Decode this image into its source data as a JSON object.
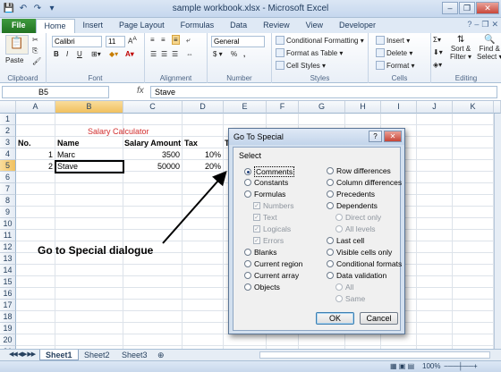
{
  "window": {
    "title": "sample workbook.xlsx - Microsoft Excel"
  },
  "qat": [
    "💾",
    "↶",
    "↷",
    "▾"
  ],
  "tabs": [
    "File",
    "Home",
    "Insert",
    "Page Layout",
    "Formulas",
    "Data",
    "Review",
    "View",
    "Developer"
  ],
  "ribbon": {
    "clipboard": {
      "label": "Clipboard",
      "paste": "Paste"
    },
    "font": {
      "label": "Font",
      "name": "Calibri",
      "size": "11",
      "bold": "B",
      "italic": "I",
      "underline": "U"
    },
    "alignment": {
      "label": "Alignment"
    },
    "number": {
      "label": "Number",
      "format": "General",
      "currency": "$ ▾",
      "percent": "%",
      "comma": ","
    },
    "styles": {
      "label": "Styles",
      "cond": "Conditional Formatting ▾",
      "table": "Format as Table ▾",
      "cell": "Cell Styles ▾"
    },
    "cells": {
      "label": "Cells",
      "insert": "Insert ▾",
      "delete": "Delete ▾",
      "format": "Format ▾"
    },
    "editing": {
      "label": "Editing",
      "sort": "Sort &",
      "sort2": "Filter ▾",
      "find": "Find &",
      "find2": "Select ▾"
    }
  },
  "formula_bar": {
    "namebox": "B5",
    "fx": "fx",
    "value": "Stave"
  },
  "columns": [
    "A",
    "B",
    "C",
    "D",
    "E",
    "F",
    "G",
    "H",
    "I",
    "J",
    "K"
  ],
  "rows": [
    "1",
    "2",
    "3",
    "4",
    "5",
    "6",
    "7",
    "8",
    "9",
    "10",
    "11",
    "12",
    "13",
    "14",
    "15",
    "16",
    "17",
    "18",
    "19",
    "20",
    "21"
  ],
  "cells": {
    "title": "Salary Calculator",
    "h_no": "No.",
    "h_name": "Name",
    "h_salary": "Salary Amount",
    "h_tax": "Tax",
    "h_t": "T",
    "r1_no": "1",
    "r1_name": "Marc",
    "r1_salary": "3500",
    "r1_tax": "10%",
    "r2_no": "2",
    "r2_name": "Stave",
    "r2_salary": "50000",
    "r2_tax": "20%"
  },
  "annotation": "Go to Special dialogue",
  "sheets": [
    "Sheet1",
    "Sheet2",
    "Sheet3"
  ],
  "status": {
    "zoom": "100%"
  },
  "dialog": {
    "title": "Go To Special",
    "select_label": "Select",
    "left": [
      {
        "label": "Comments",
        "type": "radio",
        "on": true
      },
      {
        "label": "Constants",
        "type": "radio"
      },
      {
        "label": "Formulas",
        "type": "radio"
      },
      {
        "label": "Numbers",
        "type": "check",
        "dis": true
      },
      {
        "label": "Text",
        "type": "check",
        "dis": true
      },
      {
        "label": "Logicals",
        "type": "check",
        "dis": true
      },
      {
        "label": "Errors",
        "type": "check",
        "dis": true
      },
      {
        "label": "Blanks",
        "type": "radio"
      },
      {
        "label": "Current region",
        "type": "radio"
      },
      {
        "label": "Current array",
        "type": "radio"
      },
      {
        "label": "Objects",
        "type": "radio"
      }
    ],
    "right": [
      {
        "label": "Row differences",
        "type": "radio"
      },
      {
        "label": "Column differences",
        "type": "radio"
      },
      {
        "label": "Precedents",
        "type": "radio"
      },
      {
        "label": "Dependents",
        "type": "radio"
      },
      {
        "label": "Direct only",
        "type": "radio",
        "dis": true
      },
      {
        "label": "All levels",
        "type": "radio",
        "dis": true
      },
      {
        "label": "Last cell",
        "type": "radio"
      },
      {
        "label": "Visible cells only",
        "type": "radio"
      },
      {
        "label": "Conditional formats",
        "type": "radio"
      },
      {
        "label": "Data validation",
        "type": "radio"
      },
      {
        "label": "All",
        "type": "radio",
        "dis": true
      },
      {
        "label": "Same",
        "type": "radio",
        "dis": true
      }
    ],
    "ok": "OK",
    "cancel": "Cancel"
  }
}
